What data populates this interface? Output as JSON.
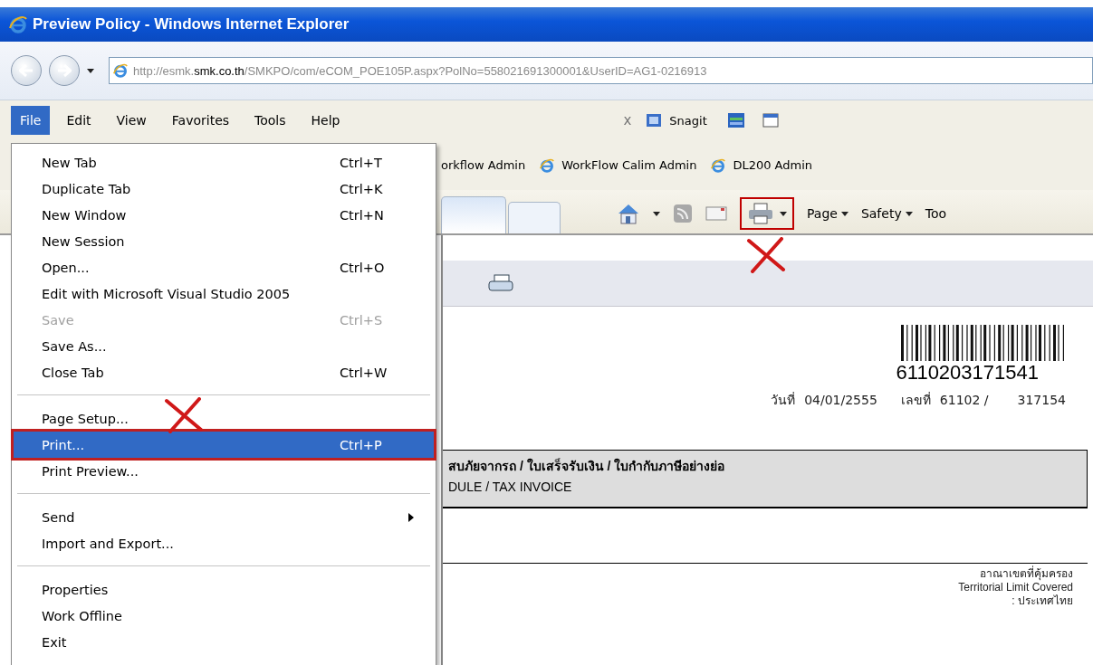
{
  "window": {
    "title": "Preview Policy - Windows Internet Explorer"
  },
  "address_bar": {
    "url_start": "http://esmk.",
    "url_domain": "smk.co.th",
    "url_end": "/SMKPO/com/eCOM_POE105P.aspx?PolNo=558021691300001&UserID=AG1-0216913"
  },
  "menu_bar": [
    {
      "label": "File",
      "selected": true
    },
    {
      "label": "Edit",
      "selected": false
    },
    {
      "label": "View",
      "selected": false
    },
    {
      "label": "Favorites",
      "selected": false
    },
    {
      "label": "Tools",
      "selected": false
    },
    {
      "label": "Help",
      "selected": false
    }
  ],
  "addon_toolbar": {
    "close": "x",
    "label": "Snagit"
  },
  "favorites": [
    "orkflow Admin",
    "WorkFlow Calim Admin",
    "DL200 Admin"
  ],
  "tabs": [
    {
      "selected": true
    },
    {
      "selected": false
    }
  ],
  "command_bar": {
    "print_highlighted": true,
    "menus": [
      "Page",
      "Safety",
      "Too"
    ]
  },
  "document": {
    "barcode_number": "6110203171541",
    "date_label": "วันที่",
    "date": "04/01/2555",
    "number_label": "เลขที่",
    "number": "61102 /",
    "number_suffix": "317154",
    "heading_lines": [
      "สบภัยจากรถ / ใบเสร็จรับเงิน / ใบกำกับภาษีอย่างย่อ",
      "DULE / TAX INVOICE"
    ],
    "territory": [
      "อาณาเขตที่คุ้มครอง",
      "Territorial Limit Covered",
      ": ประเทศไทย"
    ]
  },
  "file_menu": [
    {
      "kind": "item",
      "label": "New Tab",
      "shortcut": "Ctrl+T",
      "disabled": false,
      "selected": false
    },
    {
      "kind": "item",
      "label": "Duplicate Tab",
      "shortcut": "Ctrl+K",
      "disabled": false,
      "selected": false
    },
    {
      "kind": "item",
      "label": "New Window",
      "shortcut": "Ctrl+N",
      "disabled": false,
      "selected": false
    },
    {
      "kind": "item",
      "label": "New Session",
      "disabled": false,
      "selected": false
    },
    {
      "kind": "item",
      "label": "Open...",
      "shortcut": "Ctrl+O",
      "disabled": false,
      "selected": false
    },
    {
      "kind": "item",
      "label": "Edit with Microsoft Visual Studio 2005",
      "disabled": false,
      "selected": false
    },
    {
      "kind": "item",
      "label": "Save",
      "shortcut": "Ctrl+S",
      "disabled": true,
      "selected": false
    },
    {
      "kind": "item",
      "label": "Save As...",
      "disabled": false,
      "selected": false
    },
    {
      "kind": "item",
      "label": "Close Tab",
      "shortcut": "Ctrl+W",
      "disabled": false,
      "selected": false
    },
    {
      "kind": "separator"
    },
    {
      "kind": "item",
      "label": "Page Setup...",
      "disabled": false,
      "selected": false
    },
    {
      "kind": "item",
      "label": "Print...",
      "shortcut": "Ctrl+P",
      "disabled": false,
      "selected": true
    },
    {
      "kind": "item",
      "label": "Print Preview...",
      "disabled": false,
      "selected": false
    },
    {
      "kind": "separator"
    },
    {
      "kind": "submenu",
      "label": "Send",
      "disabled": false,
      "selected": false
    },
    {
      "kind": "item",
      "label": "Import and Export...",
      "disabled": false,
      "selected": false
    },
    {
      "kind": "separator"
    },
    {
      "kind": "item",
      "label": "Properties",
      "disabled": false,
      "selected": false
    },
    {
      "kind": "item",
      "label": "Work Offline",
      "disabled": false,
      "selected": false
    },
    {
      "kind": "item",
      "label": "Exit",
      "disabled": false,
      "selected": false
    }
  ]
}
